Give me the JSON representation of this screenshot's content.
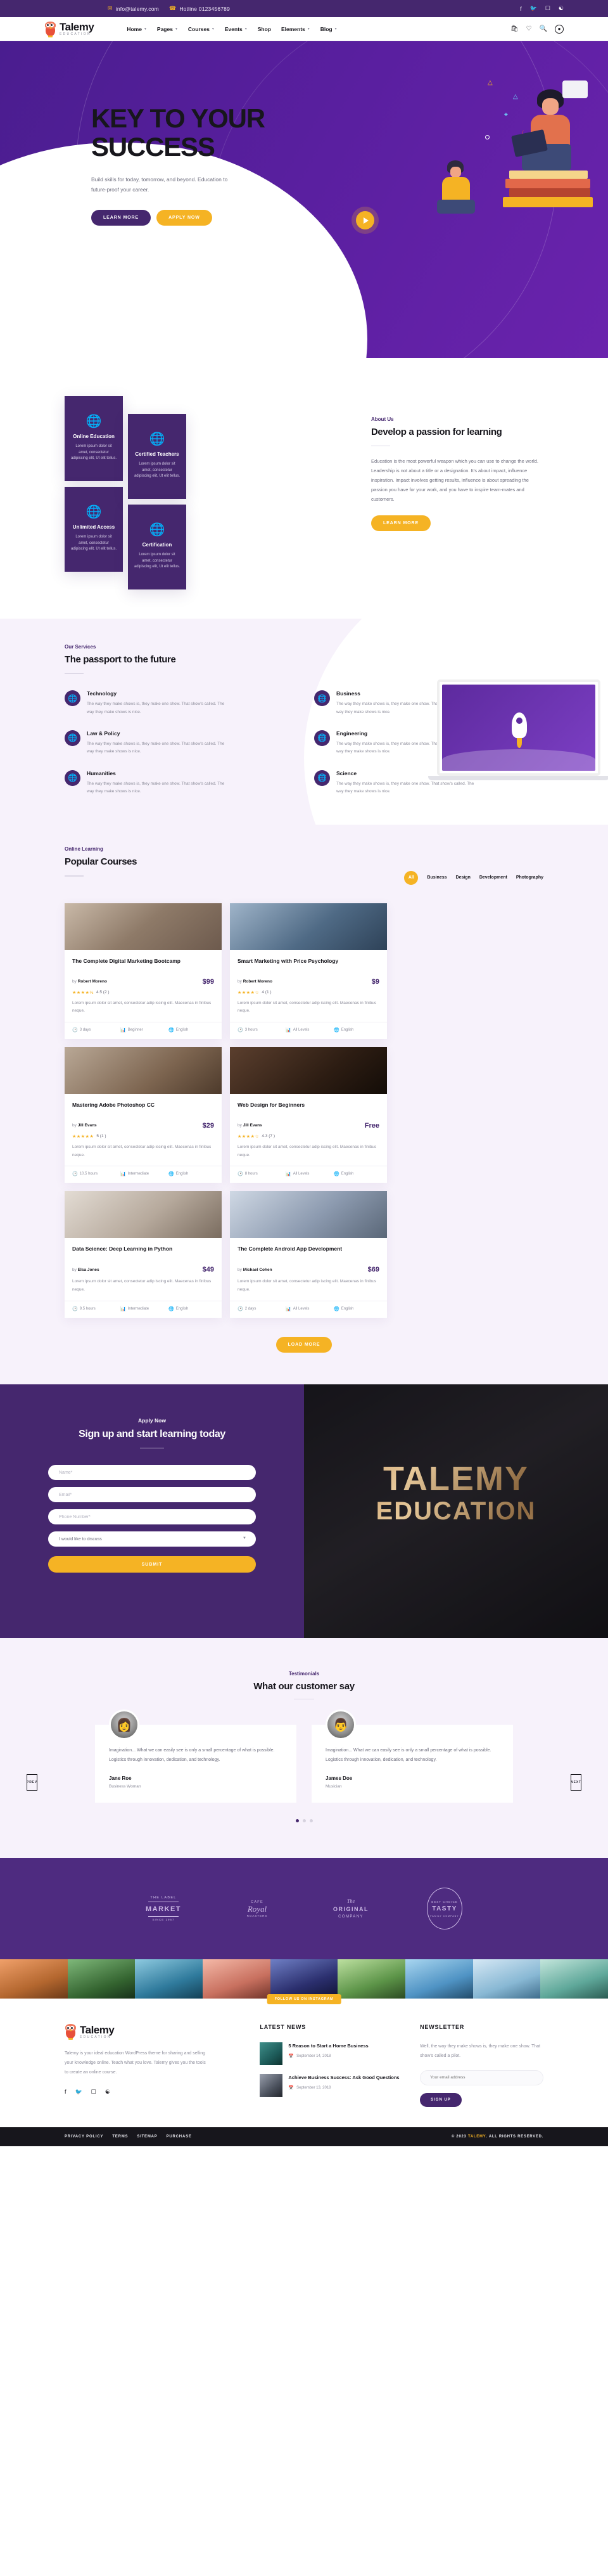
{
  "topbar": {
    "email": "info@talemy.com",
    "hotline": "Hotline 0123456789",
    "email_icon": "envelope-icon",
    "phone_icon": "phone-icon",
    "socials": [
      "f",
      "✉",
      "□",
      "Ⓟ"
    ]
  },
  "nav": {
    "brand_name": "Talemy",
    "brand_sub": "EDUCATION",
    "items": [
      {
        "label": "Home",
        "has_dropdown": true
      },
      {
        "label": "Pages",
        "has_dropdown": true
      },
      {
        "label": "Courses",
        "has_dropdown": true
      },
      {
        "label": "Events",
        "has_dropdown": true
      },
      {
        "label": "Shop",
        "has_dropdown": false
      },
      {
        "label": "Elements",
        "has_dropdown": true
      },
      {
        "label": "Blog",
        "has_dropdown": true
      }
    ],
    "icons": [
      "bag-icon",
      "heart-icon",
      "search-icon",
      "user-icon"
    ]
  },
  "hero": {
    "title_line1": "KEY TO YOUR",
    "title_line2": "SUCCESS",
    "subtitle": "Build skills for today, tomorrow, and beyond. Education to future-proof your career.",
    "btn_primary": "LEARN MORE",
    "btn_secondary": "APPLY NOW",
    "play_icon": "play-icon"
  },
  "features": {
    "cards": [
      {
        "icon": "globe-icon",
        "title": "Online Education",
        "text": "Lorem ipsum dolor sit amet, consectetur adipiscing elit, Ut elit tellus."
      },
      {
        "icon": "globe-icon",
        "title": "Certified Teachers",
        "text": "Lorem ipsum dolor sit amet, consectetur adipiscing elit, Ut elit tellus."
      },
      {
        "icon": "globe-icon",
        "title": "Unlimited Access",
        "text": "Lorem ipsum dolor sit amet, consectetur adipiscing elit, Ut elit tellus."
      },
      {
        "icon": "globe-icon",
        "title": "Certification",
        "text": "Lorem ipsum dolor sit amet, consectetur adipiscing elit, Ut elit tellus."
      }
    ],
    "about": {
      "eyebrow": "About Us",
      "title": "Develop a passion for learning",
      "paragraph": "Education is the most powerful weapon which you can use to change the world. Leadership is not about a title or a designation. It's about impact, influence inspiration. Impact involves getting results, influence is about spreading the passion you have for your work, and you have to inspire team-mates and customers.",
      "button": "LEARN MORE"
    }
  },
  "services": {
    "eyebrow": "Our Services",
    "title": "The passport to the future",
    "items": [
      {
        "icon": "globe-icon",
        "title": "Technology",
        "text": "The way they make shows is, they make one show. That show's called. The way they make shows is nice."
      },
      {
        "icon": "globe-icon",
        "title": "Business",
        "text": "The way they make shows is, they make one show. That show's called. The way they make shows is nice."
      },
      {
        "icon": "globe-icon",
        "title": "Law & Policy",
        "text": "The way they make shows is, they make one show. That show's called. The way they make shows is nice."
      },
      {
        "icon": "globe-icon",
        "title": "Engineering",
        "text": "The way they make shows is, they make one show. That show's called. The way they make shows is nice."
      },
      {
        "icon": "globe-icon",
        "title": "Humanities",
        "text": "The way they make shows is, they make one show. That show's called. The way they make shows is nice."
      },
      {
        "icon": "globe-icon",
        "title": "Science",
        "text": "The way they make shows is, they make one show. That show's called. The way they make shows is nice."
      }
    ]
  },
  "courses": {
    "eyebrow": "Online Learning",
    "title": "Popular Courses",
    "filters": [
      "All",
      "Business",
      "Design",
      "Development",
      "Photography"
    ],
    "active_filter": "All",
    "load_more": "LOAD MORE",
    "items": [
      {
        "title": "The Complete Digital Marketing Bootcamp",
        "author_prefix": "by",
        "author": "Robert Moreno",
        "price": "$99",
        "stars": "★★★★½",
        "rating": "4.5 (2 )",
        "desc": "Lorem ipsum dolor sit amet, consectetur adip iscing elit. Maecenas in finibus neque.",
        "duration": "3 days",
        "level": "Beginner",
        "language": "English"
      },
      {
        "title": "Smart Marketing with Price Psychology",
        "author_prefix": "by",
        "author": "Robert Moreno",
        "price": "$9",
        "stars": "★★★★☆",
        "rating": "4 (1 )",
        "desc": "Lorem ipsum dolor sit amet, consectetur adip iscing elit. Maecenas in finibus neque.",
        "duration": "3 hours",
        "level": "All Levels",
        "language": "English"
      },
      {
        "title": "Mastering Adobe Photoshop CC",
        "author_prefix": "by",
        "author": "Jill Evans",
        "price": "$29",
        "stars": "★★★★★",
        "rating": "5 (1 )",
        "desc": "Lorem ipsum dolor sit amet, consectetur adip iscing elit. Maecenas in finibus neque.",
        "duration": "10.5 hours",
        "level": "Intermediate",
        "language": "English"
      },
      {
        "title": "Web Design for Beginners",
        "author_prefix": "by",
        "author": "Jill Evans",
        "price": "Free",
        "stars": "★★★★☆",
        "rating": "4.3 (7 )",
        "desc": "Lorem ipsum dolor sit amet, consectetur adip iscing elit. Maecenas in finibus neque.",
        "duration": "8 hours",
        "level": "All Levels",
        "language": "English"
      },
      {
        "title": "Data Science: Deep Learning in Python",
        "author_prefix": "by",
        "author": "Elsa Jones",
        "price": "$49",
        "stars": "",
        "rating": "",
        "desc": "Lorem ipsum dolor sit amet, consectetur adip iscing elit. Maecenas in finibus neque.",
        "duration": "9.5 hours",
        "level": "Intermediate",
        "language": "English"
      },
      {
        "title": "The Complete Android App Development",
        "author_prefix": "by",
        "author": "Michael Cohen",
        "price": "$69",
        "stars": "",
        "rating": "",
        "desc": "Lorem ipsum dolor sit amet, consectetur adip iscing elit. Maecenas in finibus neque.",
        "duration": "2 days",
        "level": "All Levels",
        "language": "English"
      }
    ]
  },
  "apply": {
    "eyebrow": "Apply Now",
    "title": "Sign up and start learning today",
    "name_placeholder": "Name*",
    "email_placeholder": "Email*",
    "phone_placeholder": "Phone Number*",
    "select_value": "I would like to discuss",
    "submit": "SUBMIT",
    "banner_line1": "TALEMY",
    "banner_line2": "EDUCATION"
  },
  "testimonials": {
    "eyebrow": "Testimonials",
    "title": "What our customer say",
    "prev": "PREV",
    "next": "NEXT",
    "items": [
      {
        "quote": "Imagination... What we can easily see is only a small percentage of what is possible. Logistics through innovation, dedication, and technology.",
        "name": "Jane Roe",
        "role": "Business Woman",
        "avatar": "woman-avatar"
      },
      {
        "quote": "Imagination... What we can easily see is only a small percentage of what is possible. Logistics through innovation, dedication, and technology.",
        "name": "James Doe",
        "role": "Musician",
        "avatar": "man-avatar"
      }
    ],
    "dots": 3,
    "active_dot": 0
  },
  "brands": [
    {
      "top": "THE LABEL",
      "mid": "MARKET",
      "bot": "SINCE 1967"
    },
    {
      "top": "CAFE",
      "mid": "Royal",
      "bot": "ROASTERS"
    },
    {
      "top": "The",
      "mid": "ORIGINAL",
      "bot": "COMPANY"
    },
    {
      "top": "BEST CHOICE",
      "mid": "TASTY",
      "bot": "FAMILY COMPANY"
    }
  ],
  "gallery": {
    "badge": "FOLLOW US ON INSTAGRAM",
    "cells": 9
  },
  "footer": {
    "brand_name": "Talemy",
    "brand_sub": "EDUCATION",
    "about": "Talemy is your ideal education WordPress theme for sharing and selling your knowledge online. Teach what you love. Talemy gives you the tools to create an online course.",
    "socials": [
      "facebook-icon",
      "twitter-icon",
      "instagram-icon",
      "pinterest-icon"
    ],
    "news_title": "LATEST NEWS",
    "news": [
      {
        "title": "5 Reason to Start a Home Business",
        "date": "September 14, 2018"
      },
      {
        "title": "Achieve Business Success: Ask Good Questions",
        "date": "September 13, 2018"
      }
    ],
    "newsletter_title": "NEWSLETTER",
    "newsletter_text": "Well, the way they make shows is, they make one show. That show's called a pilot.",
    "newsletter_placeholder": "Your email address",
    "newsletter_button": "SIGN UP"
  },
  "bottombar": {
    "links": [
      "PRIVACY POLICY",
      "TERMS",
      "SITEMAP",
      "PURCHASE"
    ],
    "copyright_pre": "© 2023 ",
    "copyright_brand": "TALEMY",
    "copyright_post": ". ALL RIGHTS RESERVED."
  },
  "colors": {
    "purple": "#45276e",
    "purple_deep": "#4a1d8f",
    "yellow": "#f5b324",
    "dark": "#17161c",
    "lilac_bg": "#f7f2fb"
  }
}
